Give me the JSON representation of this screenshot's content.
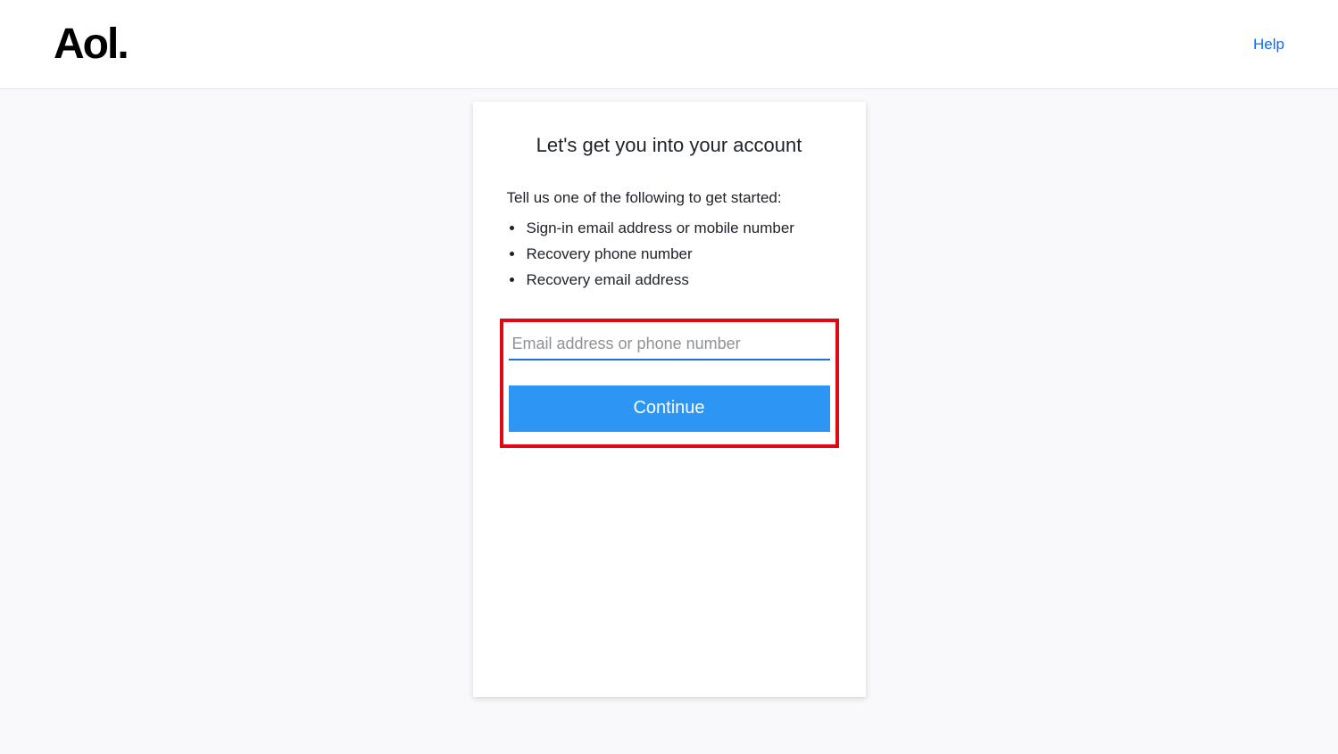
{
  "header": {
    "logo_text": "Aol.",
    "help_label": "Help"
  },
  "card": {
    "title": "Let's get you into your account",
    "subtitle": "Tell us one of the following to get started:",
    "bullets": [
      "Sign-in email address or mobile number",
      "Recovery phone number",
      "Recovery email address"
    ],
    "input_placeholder": "Email address or phone number",
    "input_value": "",
    "continue_label": "Continue"
  }
}
